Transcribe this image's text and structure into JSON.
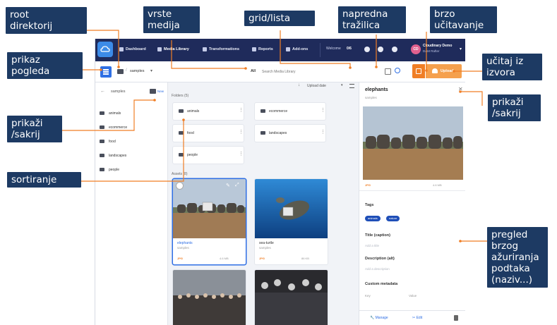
{
  "annotations": {
    "root": "root\ndirektorij",
    "media": "vrste\nmedija",
    "grid": "grid/lista",
    "advanced": "napredna\ntražilica",
    "quick_upload": "brzo\nučitavanje",
    "view": "prikaz\npogleda",
    "upload_source": "učitaj iz\nizvora",
    "toggle_left": "prikaži\n/sakrij",
    "toggle_right": "prikaži\n/sakrij",
    "sort": "sortiranje",
    "metadata": "pregled\nbrzog\nažuriranja\npodtaka\n(naziv...)"
  },
  "colors": {
    "callout_bg": "#1d3a63",
    "leader": "#f07e25",
    "nav_bg": "#1f2b5b",
    "primary": "#2f6fe4",
    "upload": "#f5a04d"
  },
  "nav": {
    "items": [
      "Dashboard",
      "Media Library",
      "Transformations",
      "Reports",
      "Add-ons"
    ],
    "welcome_label": "Welcome",
    "welcome_progress": "0/6",
    "account_name": "Cloudinary Demo",
    "account_role": "DAM Rafter"
  },
  "toolbar": {
    "breadcrumb": "samples",
    "filter_label": "All",
    "search_placeholder": "Search Media Library",
    "upload_label": "Upload"
  },
  "sidebar": {
    "title": "samples",
    "new_folder": "New",
    "folders": [
      "animals",
      "ecommerce",
      "food",
      "landscapes",
      "people"
    ]
  },
  "content": {
    "sort_field": "Upload date",
    "folders_label": "Folders (5)",
    "folders": [
      "animals",
      "ecommerce",
      "food",
      "landscapes",
      "people"
    ],
    "assets_label": "Assets (8)",
    "assets": [
      {
        "name": "elephants",
        "folder": "samples",
        "format": "JPG",
        "size": "4.6 MB"
      },
      {
        "name": "sea-turtle",
        "folder": "samples",
        "format": "JPG",
        "size": "86 KB"
      }
    ]
  },
  "panel": {
    "title": "elephants",
    "folder": "samples",
    "format": "JPG",
    "size": "4.6 MB",
    "tags_label": "Tags",
    "tags": [
      "animals",
      "nature"
    ],
    "title_label": "Title (caption)",
    "title_placeholder": "Add a title",
    "desc_label": "Description (alt)",
    "desc_placeholder": "Add a description",
    "custom_meta_label": "Custom metadata",
    "meta_key": "Key",
    "meta_value": "Value",
    "manage_label": "Manage",
    "edit_label": "Edit"
  }
}
